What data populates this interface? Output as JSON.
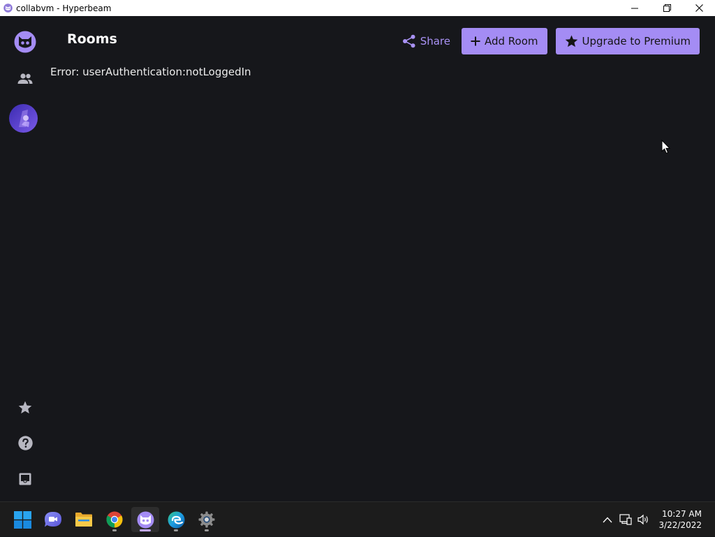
{
  "window": {
    "title": "collabvm - Hyperbeam",
    "icon": "hyperbeam-icon"
  },
  "sidebar": {
    "items": [
      {
        "name": "hyperbeam-logo",
        "icon": "hyperbeam-logo-icon"
      },
      {
        "name": "friends",
        "icon": "people-icon"
      },
      {
        "name": "profile",
        "icon": "avatar"
      },
      {
        "name": "premium",
        "icon": "star-icon"
      },
      {
        "name": "help",
        "icon": "help-icon"
      },
      {
        "name": "inbox",
        "icon": "inbox-icon"
      }
    ]
  },
  "header": {
    "title": "Rooms",
    "share_label": "Share",
    "add_room_label": "Add Room",
    "upgrade_label": "Upgrade to Premium"
  },
  "main": {
    "error": "Error: userAuthentication:notLoggedIn"
  },
  "colors": {
    "accent": "#a48cf4",
    "background": "#16171b",
    "taskbar": "#1c1c1c"
  },
  "taskbar": {
    "apps": [
      {
        "name": "start",
        "icon": "windows-start-icon"
      },
      {
        "name": "teams-chat",
        "icon": "chat-icon"
      },
      {
        "name": "file-explorer",
        "icon": "folder-icon"
      },
      {
        "name": "chrome",
        "icon": "chrome-icon"
      },
      {
        "name": "hyperbeam",
        "icon": "hyperbeam-icon",
        "active": true
      },
      {
        "name": "edge",
        "icon": "edge-icon"
      },
      {
        "name": "settings",
        "icon": "settings-gear-icon"
      }
    ],
    "time": "10:27 AM",
    "date": "3/22/2022"
  }
}
